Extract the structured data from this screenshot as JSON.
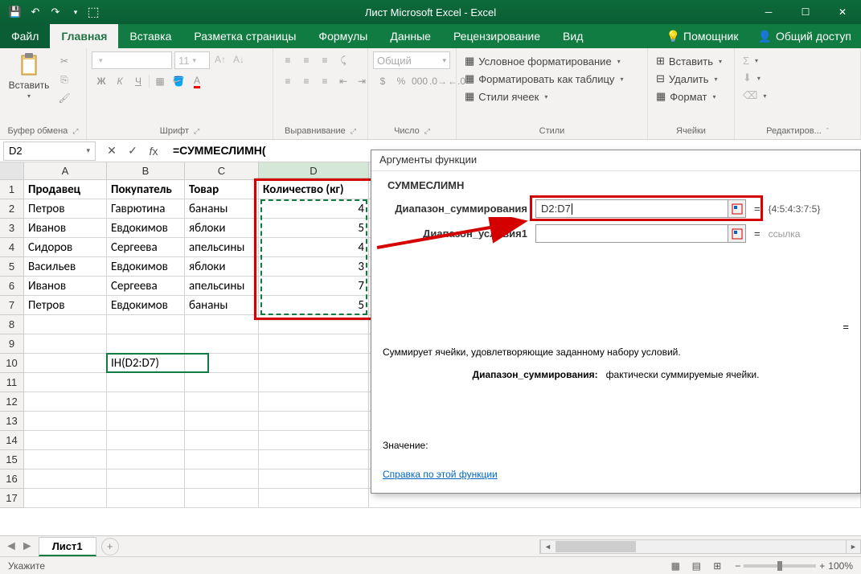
{
  "title": "Лист Microsoft Excel - Excel",
  "tabs": {
    "file": "Файл",
    "home": "Главная",
    "insert": "Вставка",
    "layout": "Разметка страницы",
    "formulas": "Формулы",
    "data": "Данные",
    "review": "Рецензирование",
    "view": "Вид",
    "helper": "Помощник",
    "share": "Общий доступ"
  },
  "ribbon": {
    "clipboard": {
      "paste": "Вставить",
      "label": "Буфер обмена"
    },
    "font": {
      "label": "Шрифт",
      "fontsize": "11"
    },
    "align": {
      "label": "Выравнивание"
    },
    "number": {
      "label": "Число",
      "format": "Общий"
    },
    "styles": {
      "label": "Стили",
      "cond": "Условное форматирование",
      "table": "Форматировать как таблицу",
      "cell": "Стили ячеек"
    },
    "cells": {
      "label": "Ячейки",
      "insert": "Вставить",
      "delete": "Удалить",
      "format": "Формат"
    },
    "editing": {
      "label": "Редактиров..."
    }
  },
  "namebox": "D2",
  "formula": "=СУММЕСЛИМН(",
  "columns": [
    "A",
    "B",
    "C",
    "D"
  ],
  "headers": {
    "A": "Продавец",
    "B": "Покупатель",
    "C": "Товар",
    "D": "Количество (кг)"
  },
  "rows": [
    {
      "n": 1
    },
    {
      "n": 2,
      "A": "Петров",
      "B": "Гаврютина",
      "C": "бананы",
      "D": "4"
    },
    {
      "n": 3,
      "A": "Иванов",
      "B": "Евдокимов",
      "C": "яблоки",
      "D": "5"
    },
    {
      "n": 4,
      "A": "Сидоров",
      "B": "Сергеева",
      "C": "апельсины",
      "D": "4"
    },
    {
      "n": 5,
      "A": "Васильев",
      "B": "Евдокимов",
      "C": "яблоки",
      "D": "3"
    },
    {
      "n": 6,
      "A": "Иванов",
      "B": "Сергеева",
      "C": "апельсины",
      "D": "7"
    },
    {
      "n": 7,
      "A": "Петров",
      "B": "Евдокимов",
      "C": "бананы",
      "D": "5"
    },
    {
      "n": 8
    },
    {
      "n": 9
    },
    {
      "n": 10,
      "B": "ІН(D2:D7)"
    },
    {
      "n": 11
    },
    {
      "n": 12
    },
    {
      "n": 13
    },
    {
      "n": 14
    },
    {
      "n": 15
    },
    {
      "n": 16
    },
    {
      "n": 17
    }
  ],
  "dialog": {
    "title": "Аргументы функции",
    "func": "СУММЕСЛИМН",
    "arg1": {
      "label": "Диапазон_суммирования",
      "value": "D2:D7",
      "result": "{4:5:4:3:7:5}"
    },
    "arg2": {
      "label": "Диапазон_условия1",
      "value": "",
      "result": "ссылка"
    },
    "desc": "Суммирует ячейки, удовлетворяющие заданному набору условий.",
    "argdesc_label": "Диапазон_суммирования:",
    "argdesc_text": "фактически суммируемые ячейки.",
    "value_label": "Значение:",
    "help": "Справка по этой функции"
  },
  "sheetname": "Лист1",
  "status": "Укажите",
  "zoom": "100%"
}
